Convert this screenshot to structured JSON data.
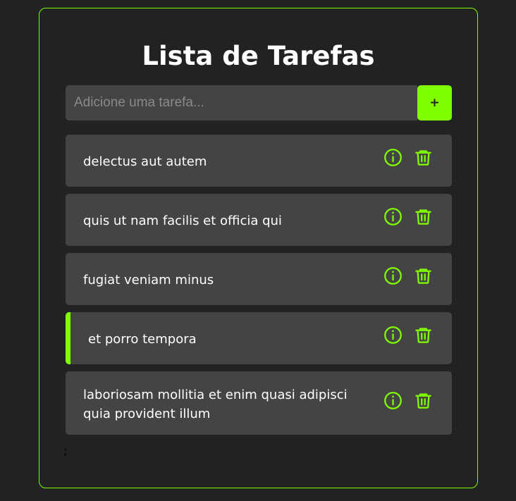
{
  "app": {
    "title": "Lista de Tarefas",
    "accent_color": "#7fff00",
    "background_color": "#222222",
    "card_color": "#444444"
  },
  "add_form": {
    "input_placeholder": "Adicione uma tarefa...",
    "input_value": "",
    "add_button_label": "+"
  },
  "tasks": [
    {
      "text": "delectus aut autem",
      "selected": false,
      "info_icon": "info-circle-icon",
      "delete_icon": "trash-icon"
    },
    {
      "text": "quis ut nam facilis et officia qui",
      "selected": false,
      "info_icon": "info-circle-icon",
      "delete_icon": "trash-icon"
    },
    {
      "text": "fugiat veniam minus",
      "selected": false,
      "info_icon": "info-circle-icon",
      "delete_icon": "trash-icon"
    },
    {
      "text": "et porro tempora",
      "selected": true,
      "info_icon": "info-circle-icon",
      "delete_icon": "trash-icon"
    },
    {
      "text": "laboriosam mollitia et enim quasi adipisci quia provident illum",
      "selected": false,
      "info_icon": "info-circle-icon",
      "delete_icon": "trash-icon"
    }
  ],
  "footer": {
    "stray_text": ";"
  }
}
